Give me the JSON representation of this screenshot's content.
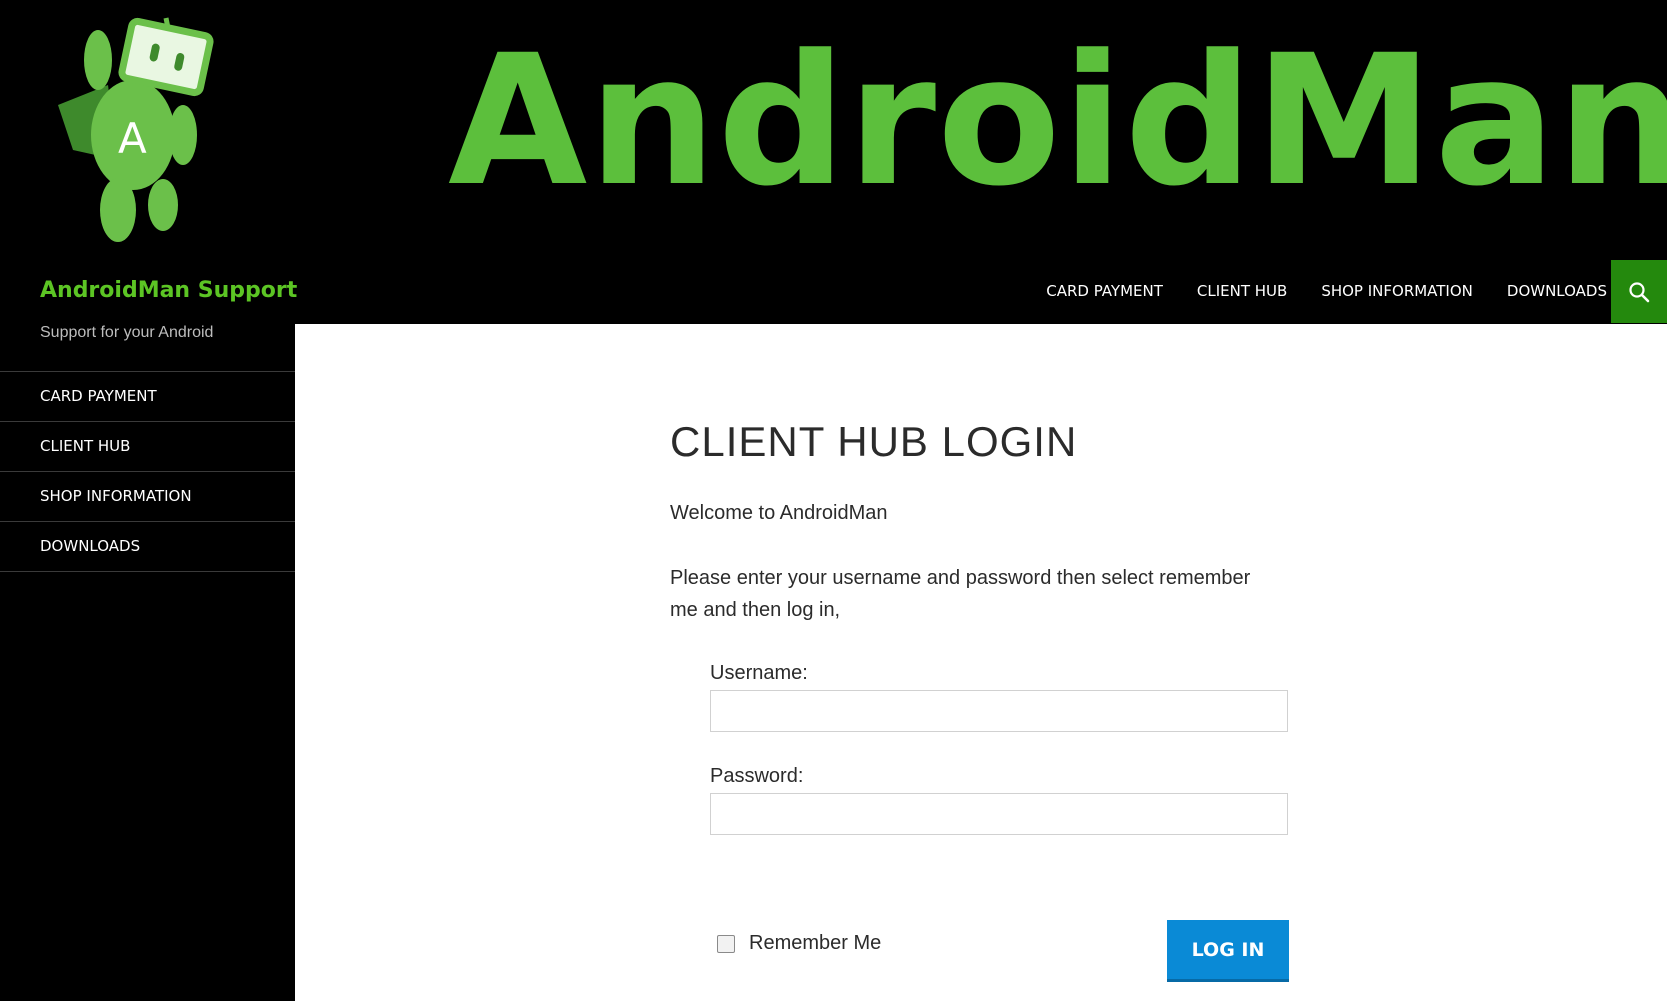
{
  "header": {
    "wordmark": "AndroidMan",
    "site_title": "AndroidMan Support",
    "site_description": "Support for your Android",
    "logo_letter": "A",
    "brand_color": "#5cbf3c"
  },
  "nav": {
    "items": [
      "CARD PAYMENT",
      "CLIENT HUB",
      "SHOP INFORMATION",
      "DOWNLOADS"
    ],
    "search_icon": "search-icon",
    "search_bg": "#24890d"
  },
  "sidebar": {
    "items": [
      "CARD PAYMENT",
      "CLIENT HUB",
      "SHOP INFORMATION",
      "DOWNLOADS"
    ]
  },
  "main": {
    "title": "CLIENT HUB LOGIN",
    "welcome": "Welcome to AndroidMan",
    "instructions": "Please enter your username and password then select remember me and then log in,",
    "form": {
      "username_label": "Username:",
      "username_value": "",
      "password_label": "Password:",
      "password_value": "",
      "remember_label": "Remember Me",
      "remember_checked": false,
      "login_label": "LOG IN",
      "button_color": "#0a8ad6"
    }
  }
}
